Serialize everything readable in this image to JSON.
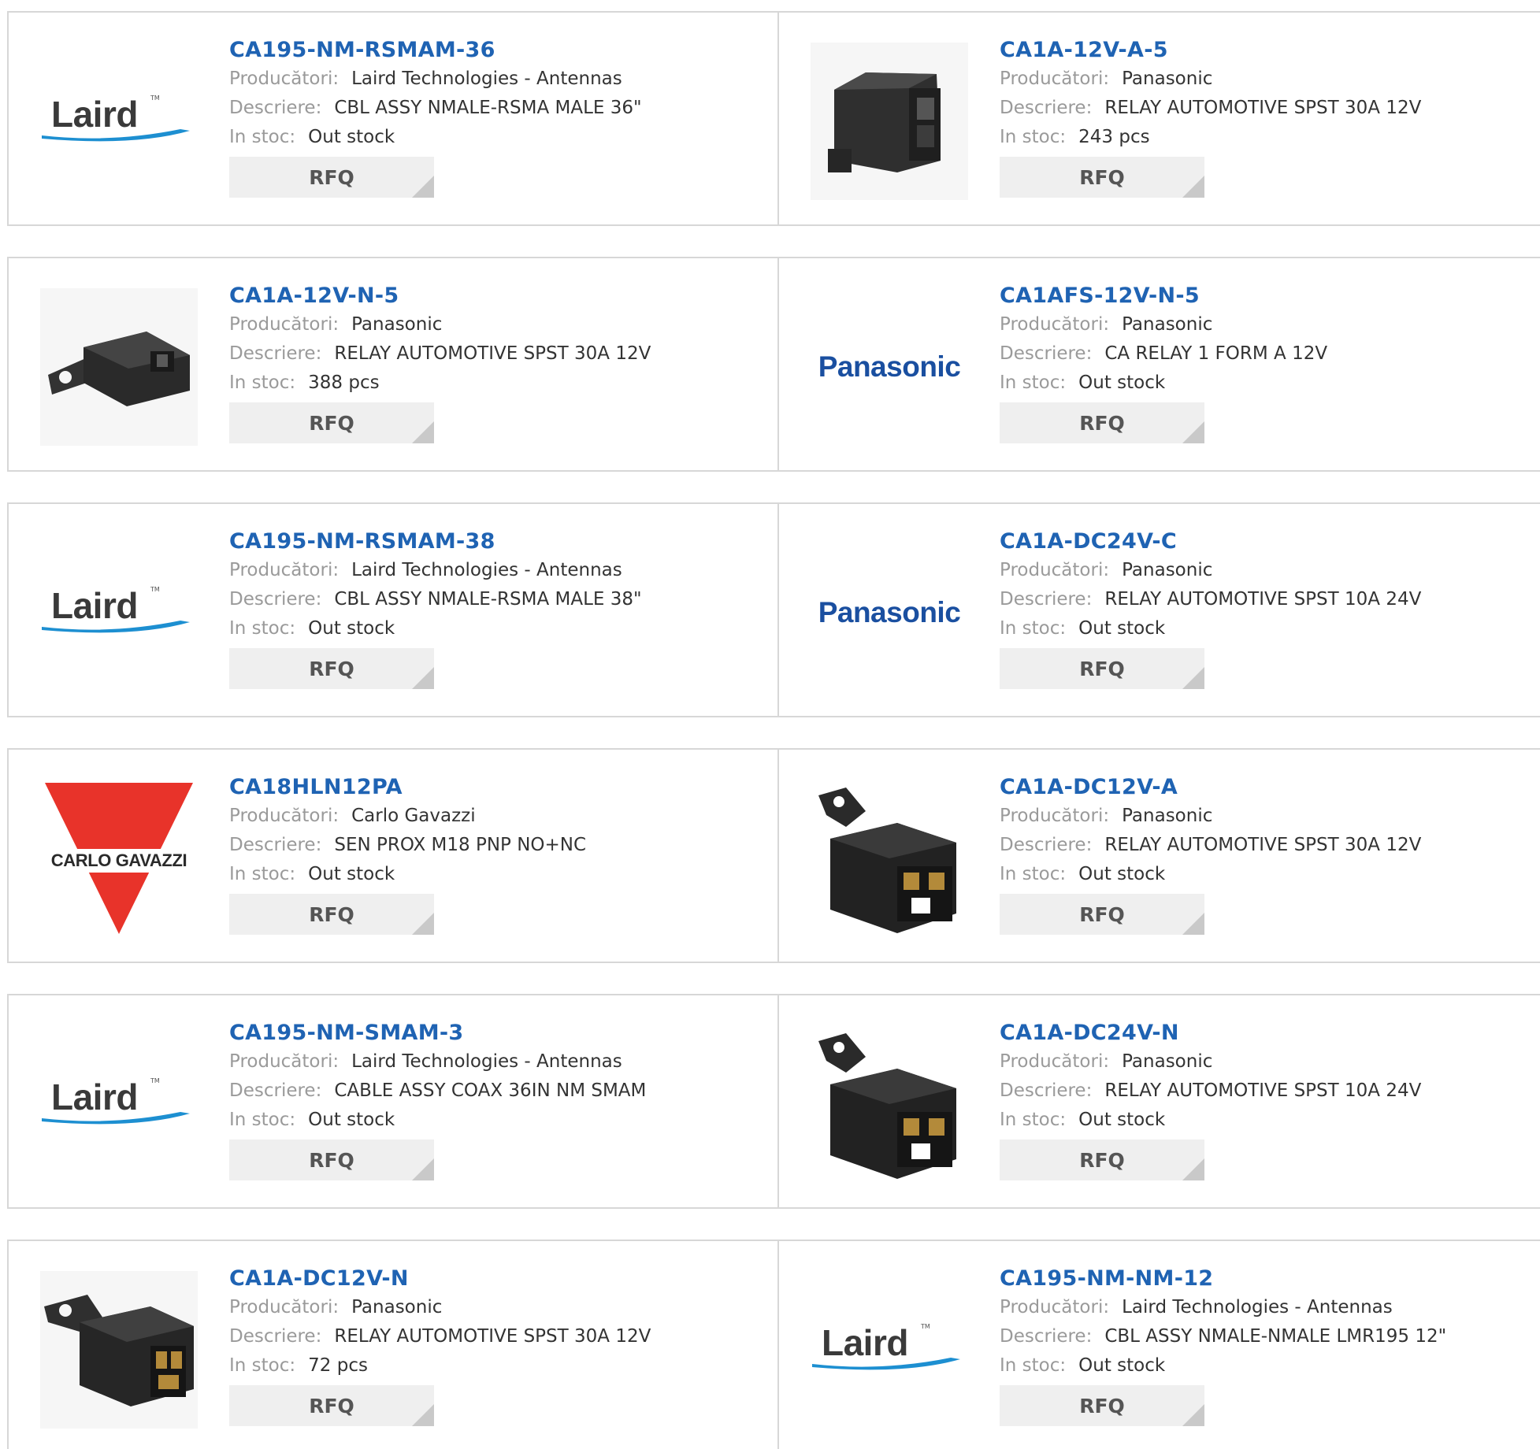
{
  "labels": {
    "manufacturer": "Producători:",
    "description": "Descriere:",
    "stock": "In stoc:",
    "rfq": "RFQ"
  },
  "brand_logos": {
    "laird": "Laird",
    "panasonic": "Panasonic",
    "carlo_gavazzi": "CARLO GAVAZZI"
  },
  "colors": {
    "part_link": "#1f63b3",
    "panasonic_blue": "#1a4fa0",
    "laird_swoosh": "#1d8fd1",
    "carlo_red": "#e8332a",
    "border": "#d7d7d7"
  },
  "products": [
    {
      "part": "CA195-NM-RSMAM-36",
      "manufacturer": "Laird Technologies - Antennas",
      "description": "CBL ASSY NMALE-RSMA MALE 36\"",
      "stock": "Out stock",
      "image": "laird-logo"
    },
    {
      "part": "CA1A-12V-A-5",
      "manufacturer": "Panasonic",
      "description": "RELAY AUTOMOTIVE SPST 30A 12V",
      "stock": "243 pcs",
      "image": "relay-photo"
    },
    {
      "part": "CA1A-12V-N-5",
      "manufacturer": "Panasonic",
      "description": "RELAY AUTOMOTIVE SPST 30A 12V",
      "stock": "388 pcs",
      "image": "relay-photo"
    },
    {
      "part": "CA1AFS-12V-N-5",
      "manufacturer": "Panasonic",
      "description": "CA RELAY 1 FORM A 12V",
      "stock": "Out stock",
      "image": "panasonic-logo"
    },
    {
      "part": "CA195-NM-RSMAM-38",
      "manufacturer": "Laird Technologies - Antennas",
      "description": "CBL ASSY NMALE-RSMA MALE 38\"",
      "stock": "Out stock",
      "image": "laird-logo"
    },
    {
      "part": "CA1A-DC24V-C",
      "manufacturer": "Panasonic",
      "description": "RELAY AUTOMOTIVE SPST 10A 24V",
      "stock": "Out stock",
      "image": "panasonic-logo"
    },
    {
      "part": "CA18HLN12PA",
      "manufacturer": "Carlo Gavazzi",
      "description": "SEN PROX M18 PNP NO+NC",
      "stock": "Out stock",
      "image": "carlo-gavazzi-logo"
    },
    {
      "part": "CA1A-DC12V-A",
      "manufacturer": "Panasonic",
      "description": "RELAY AUTOMOTIVE SPST 30A 12V",
      "stock": "Out stock",
      "image": "relay-photo"
    },
    {
      "part": "CA195-NM-SMAM-3",
      "manufacturer": "Laird Technologies - Antennas",
      "description": "CABLE ASSY COAX 36IN NM SMAM",
      "stock": "Out stock",
      "image": "laird-logo"
    },
    {
      "part": "CA1A-DC24V-N",
      "manufacturer": "Panasonic",
      "description": "RELAY AUTOMOTIVE SPST 10A 24V",
      "stock": "Out stock",
      "image": "relay-photo"
    },
    {
      "part": "CA1A-DC12V-N",
      "manufacturer": "Panasonic",
      "description": "RELAY AUTOMOTIVE SPST 30A 12V",
      "stock": "72 pcs",
      "image": "relay-photo"
    },
    {
      "part": "CA195-NM-NM-12",
      "manufacturer": "Laird Technologies - Antennas",
      "description": "CBL ASSY NMALE-NMALE LMR195 12\"",
      "stock": "Out stock",
      "image": "laird-logo"
    }
  ]
}
